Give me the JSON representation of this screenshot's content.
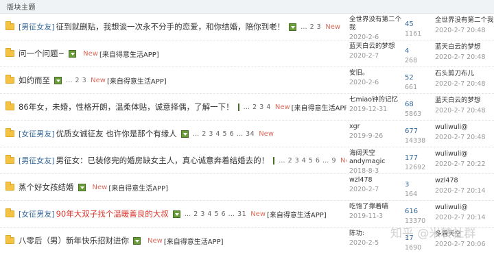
{
  "header": {
    "label": "版块主题"
  },
  "new_label": "New",
  "rows": [
    {
      "tag": "[男征女友]",
      "title": "征到就删贴，我想谈一次永不分手的恋爱，和你结婚，陪你到老！",
      "title_red": false,
      "pages": "… 2  3",
      "app_tag": "",
      "author": "全世界没有第二个我",
      "date": "2020-2-6",
      "replies": "45",
      "views": "1161",
      "last_author": "全世界没有第二个我",
      "last_date": "2020-2-7 20:48"
    },
    {
      "tag": "",
      "title": "问一个问题~",
      "title_red": false,
      "pages": "",
      "app_tag": "[来自得意生活APP]",
      "author": "蓝天白云的梦想",
      "date": "2020-2-7",
      "replies": "4",
      "views": "268",
      "last_author": "蓝天白云的梦想",
      "last_date": "2020-2-7 20:48"
    },
    {
      "tag": "",
      "title": "如约而至",
      "title_red": false,
      "pages": "… 2  3",
      "app_tag": "[来自得意生活APP]",
      "author": "安旧。",
      "date": "2020-2-6",
      "replies": "52",
      "views": "661",
      "last_author": "石头剪刀布儿",
      "last_date": "2020-2-7 20:48"
    },
    {
      "tag": "",
      "title": "86年女，未婚，性格开朗，温柔体贴，诚意择偶，了解一下！",
      "title_red": false,
      "pages": "… 2  3  4",
      "app_tag": "[来自得意生活APP]",
      "author": "七miao钟的记忆",
      "date": "2019-12-31",
      "replies": "68",
      "views": "5863",
      "last_author": "蓝天白云的梦想",
      "last_date": "2020-2-7 20:48"
    },
    {
      "tag": "[女征男友]",
      "title": "优质女诚征友 也许你是那个有缘人",
      "title_red": false,
      "pages": "… 2  3  4  5  6 … 34",
      "app_tag": "",
      "author": "xgr",
      "date": "2019-9-26",
      "replies": "677",
      "views": "14338",
      "last_author": "wuliwuli@",
      "last_date": "2020-2-7 20:48"
    },
    {
      "tag": "[男征女友]",
      "title": "男征女：已装修完的婚房缺女主人，真心诚意奔着结婚去的！",
      "title_red": false,
      "pages": "… 2  3  4  5  6 … 9",
      "app_tag": "",
      "author": "海阔天空andymagic",
      "date": "2018-8-3",
      "replies": "177",
      "views": "12692",
      "last_author": "wuliwuli@",
      "last_date": "2020-2-7 20:22"
    },
    {
      "tag": "",
      "title": "蒸个好女孩结婚",
      "title_red": false,
      "pages": "",
      "app_tag": "[来自得意生活APP]",
      "author": "wzl478",
      "date": "2020-2-7",
      "replies": "3",
      "views": "164",
      "last_author": "wzl478",
      "last_date": "2020-2-7 20:14"
    },
    {
      "tag": "[女征男友]",
      "title": "90年大双子找个温暖善良的大叔",
      "title_red": true,
      "pages": "… 2  3  4  5  6 … 31",
      "app_tag": "[来自得意生活APP]",
      "author": "吃饱了撑着喵",
      "date": "2019-11-3",
      "replies": "616",
      "views": "13370",
      "last_author": "wuliwuli@",
      "last_date": "2020-2-7 20:14"
    },
    {
      "tag": "",
      "title": "八零后（男）新年快乐招财进你",
      "title_red": false,
      "pages": "",
      "app_tag": "[来自得意生活APP]",
      "author": "陈功:",
      "date": "2020-2-5",
      "replies": "17",
      "views": "1690",
      "last_author": "多看天空",
      "last_date": "2020-2-7 20:06"
    }
  ],
  "watermark": "知乎 @米转社群"
}
